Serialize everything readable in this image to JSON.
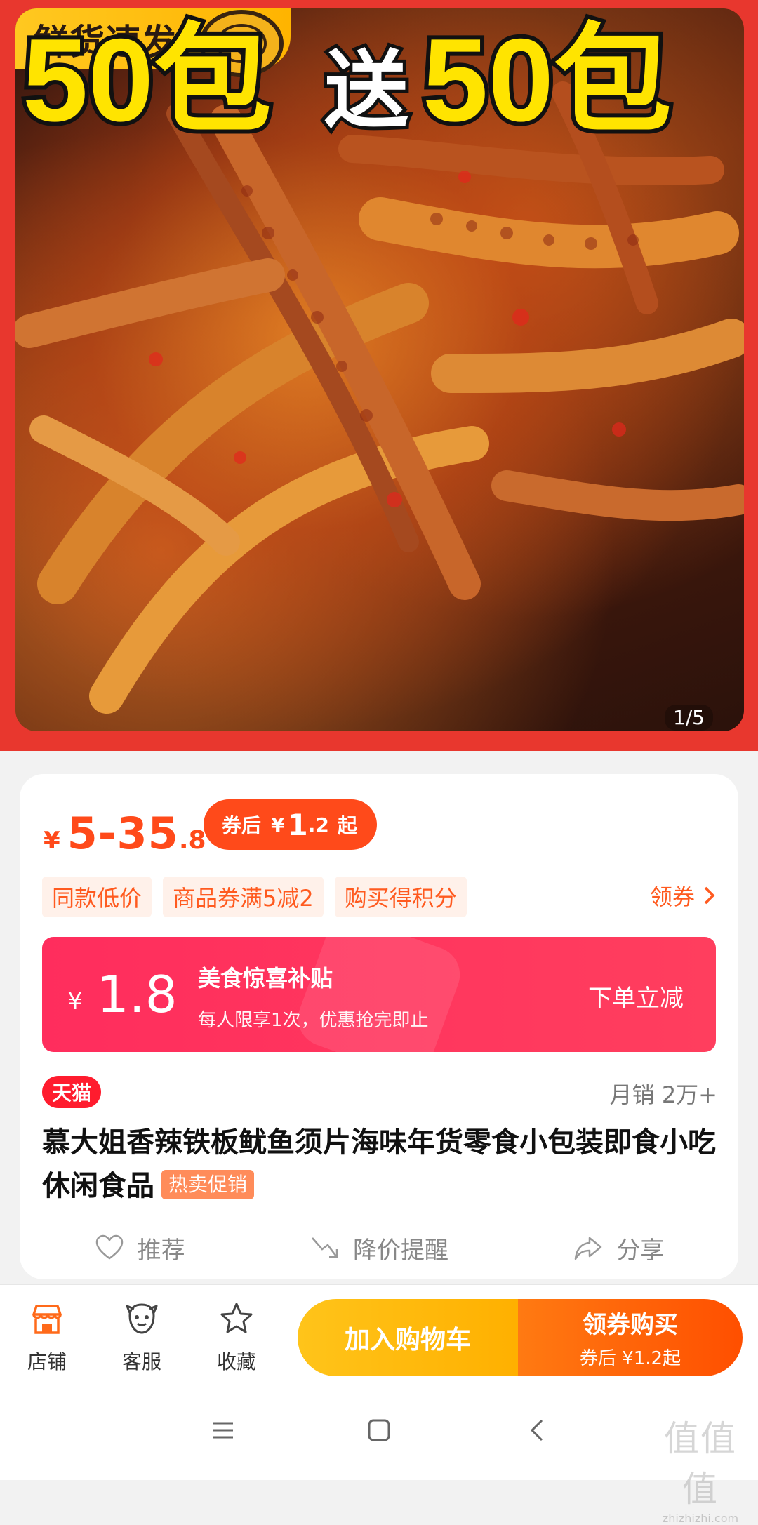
{
  "hero": {
    "badge_text": "鲜货速发",
    "promo_part1": "50包",
    "promo_mid": "送",
    "promo_part2": "50包",
    "page_indicator": "1/5"
  },
  "price": {
    "currency": "¥",
    "range_main": "5-35",
    "range_decimal": ".8",
    "after_coupon_label": "券后",
    "after_coupon_currency": "¥",
    "after_coupon_int": "1",
    "after_coupon_dec": ".2",
    "after_coupon_suffix": "起"
  },
  "chips": [
    "同款低价",
    "商品券满5减2",
    "购买得积分"
  ],
  "get_coupon_label": "领券",
  "subsidy": {
    "currency": "¥",
    "amount": "1.8",
    "title": "美食惊喜补贴",
    "desc": "每人限享1次，优惠抢完即止",
    "action": "下单立减"
  },
  "product": {
    "store_badge": "天猫",
    "monthly_sales": "月销 2万+",
    "title": "慕大姐香辣铁板鱿鱼须片海味年货零食小包装即食小吃休闲食品",
    "hot_tag": "热卖促销"
  },
  "actions": {
    "recommend": "推荐",
    "price_alert": "降价提醒",
    "share": "分享"
  },
  "bottom_bar": {
    "store": "店铺",
    "service": "客服",
    "favorite": "收藏",
    "add_cart": "加入购物车",
    "buy_line1": "领券购买",
    "buy_line2": "券后 ¥1.2起"
  },
  "watermark": {
    "big": "值值值",
    "small": "zhizhizhi.com"
  },
  "colors": {
    "accent": "#ff4a1a",
    "subsidy": "#ff2d5d",
    "cart_yellow": "#ffb000",
    "tmall_red": "#ff1c2e",
    "hero_frame": "#e8372e"
  }
}
